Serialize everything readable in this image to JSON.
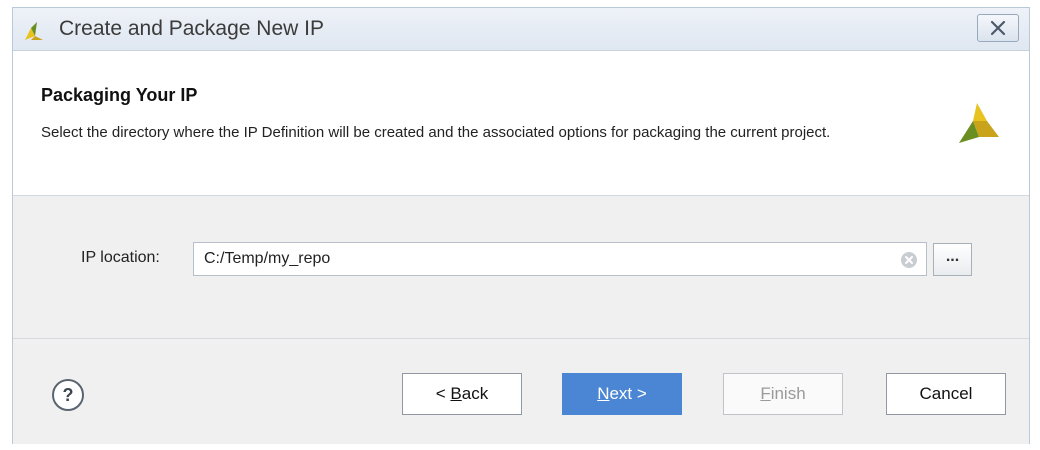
{
  "window": {
    "title": "Create and Package New IP"
  },
  "header": {
    "title": "Packaging Your IP",
    "description": "Select the directory where the IP Definition will be created and the associated options for packaging the current project."
  },
  "form": {
    "ip_location_label": "IP location:",
    "ip_location_value": "C:/Temp/my_repo",
    "browse_label": "..."
  },
  "footer": {
    "help_label": "?",
    "back": {
      "prefix": "< ",
      "mnemonic": "B",
      "rest": "ack"
    },
    "next": {
      "mnemonic": "N",
      "rest": "ext >"
    },
    "finish": {
      "mnemonic": "F",
      "rest": "inish"
    },
    "cancel": "Cancel"
  },
  "colors": {
    "accent_button": "#4a86d4",
    "logo_yellow": "#e8c31f",
    "logo_green": "#6b8e23"
  }
}
